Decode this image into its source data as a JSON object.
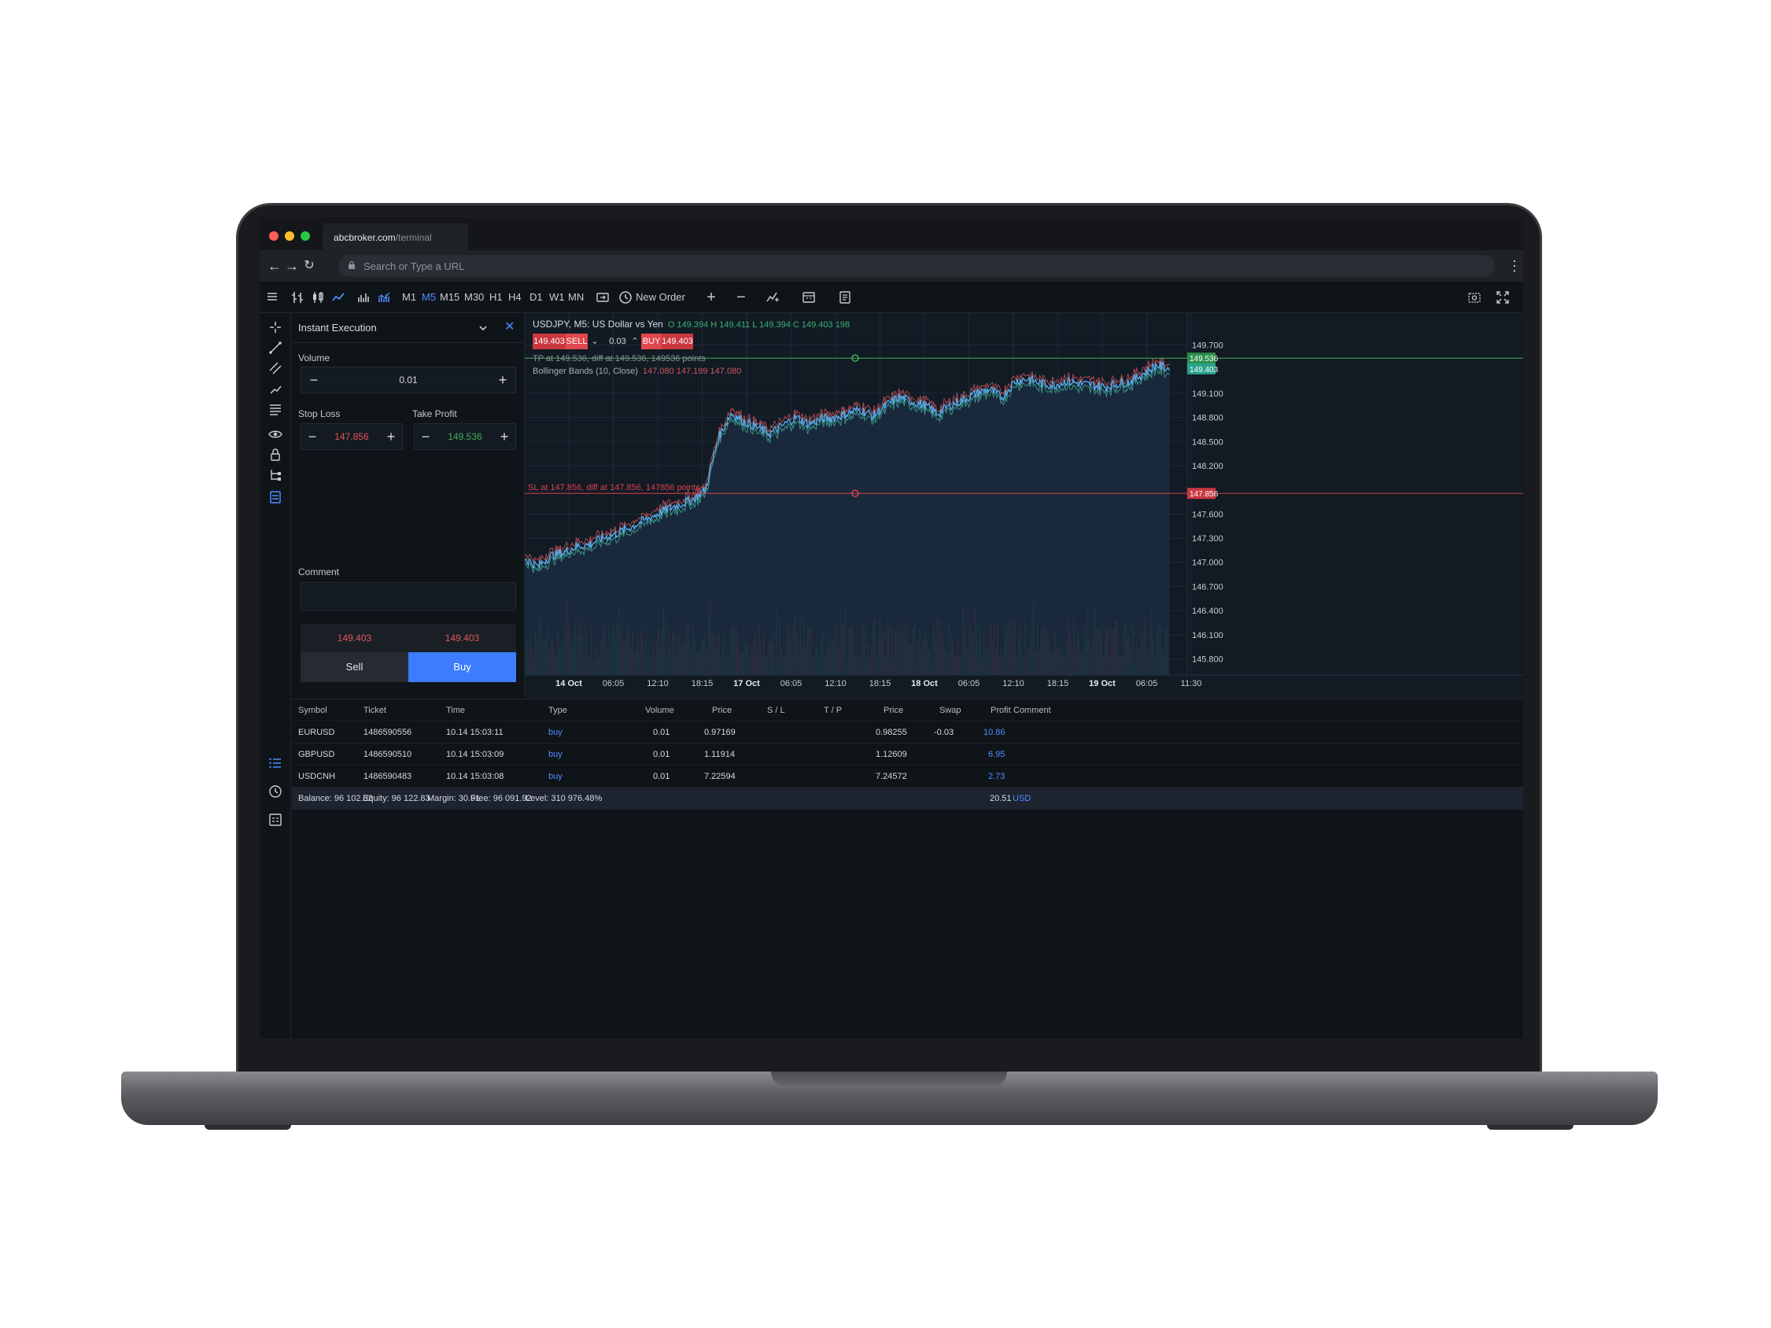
{
  "browser": {
    "tab_host": "abcbroker.com",
    "tab_path": "/terminal",
    "url_placeholder": "Search or Type a URL"
  },
  "toolbar": {
    "timeframes": [
      "M1",
      "M5",
      "M15",
      "M30",
      "H1",
      "H4",
      "D1",
      "W1",
      "MN"
    ],
    "active_timeframe": "M5",
    "new_order_label": "New Order"
  },
  "order_panel": {
    "execution_mode": "Instant Execution",
    "volume_label": "Volume",
    "volume_value": "0.01",
    "stop_loss_label": "Stop Loss",
    "stop_loss_value": "147.856",
    "take_profit_label": "Take Profit",
    "take_profit_value": "149.536",
    "comment_label": "Comment",
    "sell_price": "149.403",
    "buy_price": "149.403",
    "sell_label": "Sell",
    "buy_label": "Buy"
  },
  "chart_data": {
    "type": "line",
    "title": "USDJPY, M5: US Dollar vs Yen",
    "ohlc_text": "O 149.394 H 149.411 L 149.394 C 149.403 198",
    "trade_strip": {
      "sell_price": "149.403",
      "sell_label": "SELL",
      "lot": "0.03",
      "buy_label": "BUY",
      "buy_price": "149.403"
    },
    "tp_annotation": "TP at 149.536, diff at 149.536, 149536 points",
    "indicator_label": "Bollinger Bands (10, Close)",
    "indicator_values": "147.080 147.199 147.080",
    "sl_annotation": "SL at 147.856, diff at 147.856, 147856 points",
    "x_tick_labels": [
      "14 Oct",
      "06:05",
      "12:10",
      "18:15",
      "17 Oct",
      "06:05",
      "12:10",
      "18:15",
      "18 Oct",
      "06:05",
      "12:10",
      "18:15",
      "19 Oct",
      "06:05",
      "11:30"
    ],
    "y_tick_labels": [
      "149.700",
      "149.100",
      "148.800",
      "148.500",
      "148.200",
      "147.600",
      "147.300",
      "147.000",
      "146.700",
      "146.400",
      "146.100",
      "145.800"
    ],
    "ylim": [
      145.6,
      149.9
    ],
    "take_profit_level": 149.536,
    "stop_loss_level": 147.856,
    "current_price": 149.403,
    "tp_tag": "149.536",
    "current_tag": "149.403",
    "sl_tag": "147.856",
    "x": [
      0,
      0.02,
      0.04,
      0.06,
      0.08,
      0.1,
      0.12,
      0.14,
      0.16,
      0.18,
      0.2,
      0.22,
      0.24,
      0.26,
      0.28,
      0.3,
      0.32,
      0.34,
      0.36,
      0.38,
      0.4,
      0.42,
      0.44,
      0.46,
      0.48,
      0.5,
      0.52,
      0.54,
      0.56,
      0.58,
      0.6,
      0.62,
      0.64,
      0.66,
      0.68,
      0.7,
      0.72,
      0.74,
      0.76,
      0.78,
      0.8,
      0.82,
      0.84,
      0.86,
      0.88,
      0.9,
      0.92,
      0.94,
      0.96,
      0.98,
      1.0
    ],
    "values": [
      147.05,
      146.95,
      147.08,
      147.12,
      147.2,
      147.22,
      147.3,
      147.35,
      147.42,
      147.5,
      147.58,
      147.66,
      147.72,
      147.78,
      147.9,
      148.55,
      148.85,
      148.75,
      148.68,
      148.6,
      148.7,
      148.8,
      148.72,
      148.78,
      148.8,
      148.85,
      148.9,
      148.82,
      148.95,
      149.05,
      149.0,
      148.95,
      148.85,
      148.95,
      149.02,
      149.1,
      149.15,
      149.05,
      149.25,
      149.28,
      149.22,
      149.2,
      149.25,
      149.22,
      149.2,
      149.18,
      149.22,
      149.25,
      149.35,
      149.45,
      149.4
    ],
    "volume_max": 1
  },
  "positions": {
    "headers": [
      "Symbol",
      "Ticket",
      "Time",
      "Type",
      "Volume",
      "Price",
      "S / L",
      "T / P",
      "Price",
      "Swap",
      "Profit",
      "Comment"
    ],
    "rows": [
      {
        "symbol": "EURUSD",
        "ticket": "1486590556",
        "time": "10.14 15:03:11",
        "type": "buy",
        "volume": "0.01",
        "price": "0.97169",
        "current": "0.98255",
        "swap": "-0.03",
        "profit": "10.86"
      },
      {
        "symbol": "GBPUSD",
        "ticket": "1486590510",
        "time": "10.14 15:03:09",
        "type": "buy",
        "volume": "0.01",
        "price": "1.11914",
        "current": "1.12609",
        "swap": "",
        "profit": "6.95"
      },
      {
        "symbol": "USDCNH",
        "ticket": "1486590483",
        "time": "10.14 15:03:08",
        "type": "buy",
        "volume": "0.01",
        "price": "7.22594",
        "current": "7.24572",
        "swap": "",
        "profit": "2.73"
      }
    ],
    "summary": {
      "balance": "Balance: 96 102.32",
      "equity": "Equity: 96 122.83",
      "margin": "Margin: 30.91",
      "free": "Free: 96 091.92",
      "level": "Level: 310 976.48%",
      "total": "20.51",
      "currency": "USD"
    }
  },
  "colors": {
    "accent": "#3d7bff",
    "sell": "#d9434a",
    "profit_text": "#4c8dff",
    "tp_line": "#3fae5a",
    "sl_line": "#d9434a"
  }
}
